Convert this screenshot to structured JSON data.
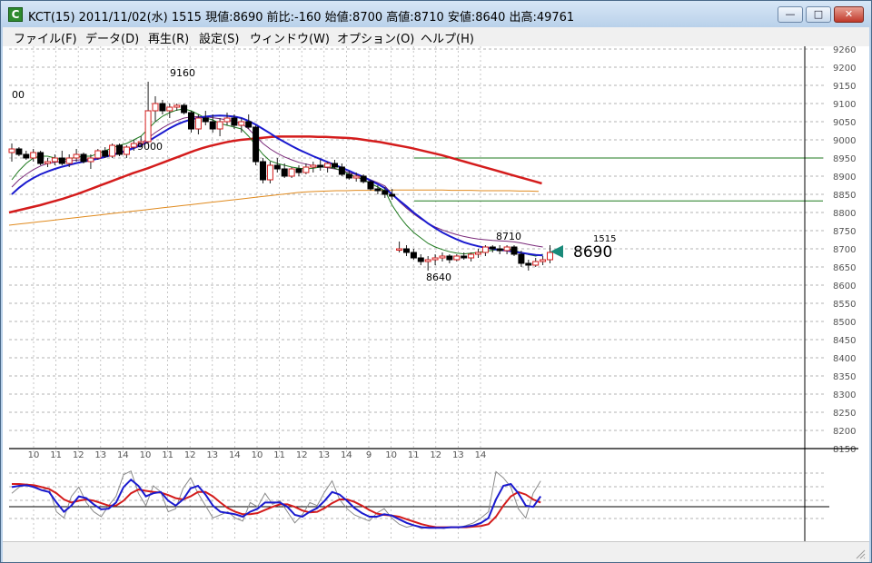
{
  "window": {
    "title": "KCT(15) 2011/11/02(水) 1515 現値:8690 前比:-160  始値:8700 高値:8710 安値:8640 出高:49761",
    "icon_letter": "C",
    "buttons": {
      "minimize": "—",
      "maximize": "□",
      "close": "✕"
    }
  },
  "menu": [
    "ファイル(F)",
    "データ(D)",
    "再生(R)",
    "設定(S)",
    "ウィンドウ(W)",
    "オプション(O)",
    "ヘルプ(H)"
  ],
  "chart_data": {
    "type": "line",
    "price_axis": {
      "ticks": [
        "9260",
        "9200",
        "9150",
        "9100",
        "9050",
        "9000",
        "8950",
        "8900",
        "8850",
        "8800",
        "8750",
        "8700",
        "8650",
        "8600",
        "8550",
        "8500",
        "8450",
        "8400",
        "8350",
        "8300",
        "8250",
        "8200",
        "8150"
      ]
    },
    "time_axis": {
      "ticks": [
        "10",
        "11",
        "12",
        "13",
        "14",
        "10",
        "11",
        "12",
        "13",
        "14",
        "10",
        "11",
        "12",
        "13",
        "14",
        "9",
        "10",
        "11",
        "12",
        "13",
        "14"
      ]
    },
    "annotations": {
      "left_edge_label": "00",
      "high_label": "9160",
      "low_label_1": "9000",
      "high_label_2": "8710",
      "low_label_2": "8640",
      "last_time": "1515",
      "last_price": "8690"
    },
    "candles": [
      [
        8965,
        8990,
        8940,
        8975
      ],
      [
        8975,
        8980,
        8955,
        8960
      ],
      [
        8960,
        8970,
        8945,
        8950
      ],
      [
        8950,
        8975,
        8940,
        8965
      ],
      [
        8965,
        8970,
        8930,
        8935
      ],
      [
        8935,
        8950,
        8925,
        8940
      ],
      [
        8940,
        8960,
        8930,
        8950
      ],
      [
        8950,
        8970,
        8930,
        8935
      ],
      [
        8935,
        8960,
        8925,
        8950
      ],
      [
        8950,
        8975,
        8940,
        8960
      ],
      [
        8960,
        8965,
        8935,
        8940
      ],
      [
        8940,
        8960,
        8920,
        8950
      ],
      [
        8950,
        8975,
        8945,
        8970
      ],
      [
        8970,
        8980,
        8950,
        8955
      ],
      [
        8955,
        8990,
        8950,
        8985
      ],
      [
        8985,
        8990,
        8955,
        8960
      ],
      [
        8960,
        8985,
        8950,
        8980
      ],
      [
        8980,
        9000,
        8970,
        8990
      ],
      [
        8990,
        9010,
        8980,
        8995
      ],
      [
        8995,
        9160,
        8990,
        9080
      ],
      [
        9080,
        9120,
        9050,
        9100
      ],
      [
        9100,
        9110,
        9070,
        9080
      ],
      [
        9080,
        9100,
        9060,
        9090
      ],
      [
        9090,
        9100,
        9080,
        9095
      ],
      [
        9095,
        9100,
        9070,
        9075
      ],
      [
        9075,
        9080,
        9020,
        9030
      ],
      [
        9030,
        9070,
        9015,
        9060
      ],
      [
        9060,
        9080,
        9040,
        9050
      ],
      [
        9050,
        9070,
        9020,
        9030
      ],
      [
        9030,
        9060,
        9010,
        9050
      ],
      [
        9050,
        9075,
        9040,
        9060
      ],
      [
        9060,
        9070,
        9030,
        9040
      ],
      [
        9040,
        9060,
        9020,
        9050
      ],
      [
        9050,
        9070,
        9030,
        9035
      ],
      [
        9035,
        9040,
        8930,
        8940
      ],
      [
        8940,
        8950,
        8880,
        8890
      ],
      [
        8890,
        8940,
        8880,
        8930
      ],
      [
        8930,
        8950,
        8910,
        8920
      ],
      [
        8920,
        8935,
        8895,
        8900
      ],
      [
        8900,
        8925,
        8895,
        8920
      ],
      [
        8920,
        8930,
        8900,
        8910
      ],
      [
        8910,
        8935,
        8905,
        8925
      ],
      [
        8925,
        8940,
        8910,
        8930
      ],
      [
        8930,
        8945,
        8915,
        8925
      ],
      [
        8925,
        8940,
        8910,
        8935
      ],
      [
        8935,
        8945,
        8920,
        8925
      ],
      [
        8925,
        8935,
        8900,
        8905
      ],
      [
        8905,
        8915,
        8890,
        8895
      ],
      [
        8895,
        8910,
        8885,
        8900
      ],
      [
        8900,
        8905,
        8880,
        8885
      ],
      [
        8885,
        8890,
        8860,
        8865
      ],
      [
        8865,
        8875,
        8850,
        8860
      ],
      [
        8860,
        8870,
        8840,
        8850
      ],
      [
        8850,
        8865,
        8835,
        8845
      ],
      [
        8700,
        8720,
        8690,
        8700
      ],
      [
        8700,
        8710,
        8680,
        8690
      ],
      [
        8690,
        8700,
        8670,
        8675
      ],
      [
        8675,
        8685,
        8655,
        8665
      ],
      [
        8665,
        8680,
        8640,
        8670
      ],
      [
        8670,
        8685,
        8655,
        8675
      ],
      [
        8675,
        8690,
        8665,
        8680
      ],
      [
        8680,
        8685,
        8660,
        8670
      ],
      [
        8670,
        8685,
        8665,
        8680
      ],
      [
        8680,
        8690,
        8670,
        8675
      ],
      [
        8675,
        8690,
        8665,
        8685
      ],
      [
        8685,
        8700,
        8675,
        8690
      ],
      [
        8690,
        8710,
        8680,
        8705
      ],
      [
        8705,
        8710,
        8690,
        8700
      ],
      [
        8700,
        8710,
        8685,
        8695
      ],
      [
        8695,
        8710,
        8685,
        8705
      ],
      [
        8705,
        8710,
        8680,
        8685
      ],
      [
        8685,
        8695,
        8650,
        8660
      ],
      [
        8660,
        8670,
        8640,
        8655
      ],
      [
        8655,
        8675,
        8650,
        8665
      ],
      [
        8665,
        8680,
        8655,
        8670
      ],
      [
        8670,
        8710,
        8660,
        8690
      ]
    ],
    "ma_green": [
      8890,
      8915,
      8935,
      8950,
      8955,
      8955,
      8950,
      8945,
      8948,
      8952,
      8955,
      8955,
      8962,
      8970,
      8978,
      8985,
      8990,
      9000,
      9010,
      9030,
      9050,
      9065,
      9075,
      9082,
      9085,
      9080,
      9070,
      9060,
      9055,
      9045,
      9040,
      9035,
      9030,
      9010,
      8985,
      8960,
      8942,
      8935,
      8930,
      8925,
      8922,
      8920,
      8922,
      8925,
      8925,
      8922,
      8915,
      8905,
      8898,
      8890,
      8880,
      8870,
      8860,
      8820,
      8790,
      8765,
      8745,
      8730,
      8715,
      8705,
      8698,
      8692,
      8688,
      8686,
      8688,
      8690,
      8693,
      8696,
      8698,
      8700,
      8696,
      8690,
      8684,
      8680,
      8685
    ],
    "ma_purple": [
      8870,
      8890,
      8905,
      8918,
      8928,
      8935,
      8938,
      8940,
      8942,
      8944,
      8946,
      8947,
      8950,
      8954,
      8960,
      8966,
      8972,
      8980,
      8990,
      9005,
      9020,
      9033,
      9044,
      9053,
      9060,
      9063,
      9064,
      9063,
      9061,
      9058,
      9055,
      9050,
      9045,
      9030,
      9010,
      8990,
      8975,
      8963,
      8953,
      8945,
      8938,
      8933,
      8929,
      8926,
      8923,
      8920,
      8916,
      8910,
      8904,
      8898,
      8890,
      8882,
      8873,
      8850,
      8830,
      8812,
      8796,
      8782,
      8770,
      8760,
      8752,
      8745,
      8739,
      8734,
      8730,
      8727,
      8725,
      8723,
      8722,
      8721,
      8719,
      8716,
      8712,
      8708,
      8705
    ],
    "ma_blue": [
      8850,
      8868,
      8883,
      8895,
      8905,
      8913,
      8920,
      8926,
      8931,
      8936,
      8940,
      8944,
      8948,
      8953,
      8958,
      8964,
      8970,
      8977,
      8985,
      8996,
      9008,
      9020,
      9032,
      9042,
      9050,
      9056,
      9061,
      9064,
      9066,
      9067,
      9066,
      9064,
      9060,
      9052,
      9042,
      9030,
      9018,
      9005,
      8994,
      8983,
      8973,
      8964,
      8955,
      8947,
      8939,
      8931,
      8923,
      8915,
      8906,
      8898,
      8888,
      8878,
      8867,
      8850,
      8833,
      8817,
      8800,
      8785,
      8770,
      8757,
      8745,
      8735,
      8726,
      8718,
      8712,
      8707,
      8703,
      8700,
      8697,
      8695,
      8692,
      8689,
      8686,
      8683,
      8682
    ],
    "ma_red": [
      8800,
      8805,
      8810,
      8815,
      8820,
      8826,
      8832,
      8838,
      8845,
      8852,
      8860,
      8868,
      8876,
      8884,
      8892,
      8900,
      8908,
      8915,
      8922,
      8930,
      8938,
      8946,
      8954,
      8962,
      8970,
      8977,
      8983,
      8988,
      8993,
      8997,
      9000,
      9002,
      9004,
      9006,
      9008,
      9009,
      9009,
      9009,
      9009,
      9009,
      9008,
      9008,
      9007,
      9006,
      9005,
      9003,
      9000,
      8997,
      8994,
      8990,
      8986,
      8982,
      8978,
      8973,
      8968,
      8963,
      8958,
      8952,
      8946,
      8940,
      8934,
      8928,
      8922,
      8916,
      8910,
      8904,
      8898,
      8892,
      8886,
      8880
    ],
    "ma_orange": [
      8765,
      8768,
      8771,
      8774,
      8777,
      8780,
      8783,
      8786,
      8789,
      8792,
      8795,
      8798,
      8801,
      8804,
      8807,
      8810,
      8813,
      8816,
      8819,
      8822,
      8825,
      8828,
      8831,
      8834,
      8837,
      8840,
      8843,
      8846,
      8849,
      8852,
      8855,
      8857,
      8858,
      8859,
      8860,
      8860,
      8861,
      8861,
      8861,
      8861,
      8862,
      8862,
      8862,
      8862,
      8862,
      8862,
      8861,
      8861,
      8861,
      8860,
      8860,
      8860,
      8860,
      8859,
      8859,
      8858
    ],
    "h_line_1": 8950,
    "h_line_2": 8832,
    "oscillator": {
      "raw_gray": [
        60,
        70,
        75,
        72,
        65,
        68,
        30,
        20,
        55,
        70,
        45,
        30,
        22,
        40,
        55,
        90,
        96,
        60,
        40,
        72,
        62,
        30,
        35,
        68,
        85,
        60,
        40,
        20,
        25,
        30,
        20,
        15,
        45,
        38,
        60,
        42,
        48,
        30,
        12,
        25,
        45,
        40,
        62,
        80,
        50,
        35,
        25,
        20,
        15,
        28,
        35,
        20,
        10,
        5,
        8,
        3,
        5,
        5,
        3,
        6,
        4,
        8,
        12,
        20,
        30,
        95,
        85,
        70,
        35,
        20,
        60,
        80
      ],
      "fast_blue": [
        70,
        72,
        73,
        70,
        65,
        62,
        45,
        30,
        40,
        55,
        52,
        42,
        34,
        35,
        45,
        70,
        82,
        72,
        55,
        60,
        62,
        48,
        40,
        50,
        68,
        72,
        58,
        40,
        30,
        28,
        26,
        22,
        30,
        35,
        45,
        45,
        45,
        38,
        25,
        22,
        30,
        36,
        48,
        62,
        58,
        48,
        36,
        28,
        22,
        22,
        26,
        24,
        18,
        12,
        8,
        5,
        4,
        4,
        4,
        5,
        5,
        6,
        8,
        12,
        20,
        50,
        72,
        75,
        60,
        40,
        38,
        55
      ],
      "slow_red": [
        75,
        75,
        74,
        73,
        70,
        67,
        60,
        50,
        45,
        48,
        50,
        48,
        44,
        40,
        40,
        48,
        60,
        66,
        64,
        62,
        61,
        57,
        52,
        50,
        55,
        62,
        62,
        55,
        45,
        36,
        30,
        26,
        26,
        28,
        33,
        38,
        42,
        42,
        38,
        32,
        29,
        30,
        36,
        44,
        50,
        50,
        46,
        40,
        33,
        27,
        25,
        24,
        22,
        18,
        14,
        10,
        7,
        5,
        5,
        5,
        5,
        5,
        6,
        7,
        10,
        22,
        40,
        55,
        62,
        58,
        50,
        45
      ]
    }
  }
}
